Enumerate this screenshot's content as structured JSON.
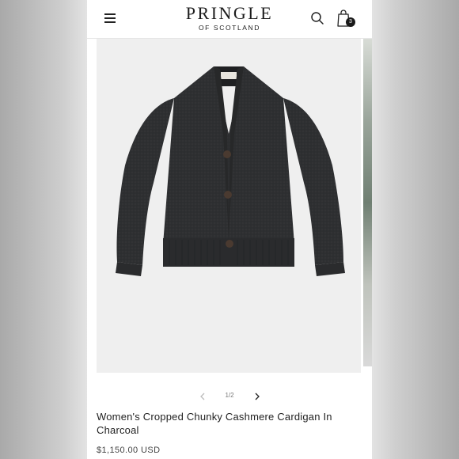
{
  "header": {
    "brand": "PRINGLE",
    "brand_sub": "OF SCOTLAND",
    "cart_count": "3",
    "icons": {
      "menu": "menu-icon",
      "search": "search-icon",
      "cart": "shopping-bag-icon"
    }
  },
  "gallery": {
    "counter": "1/2",
    "icons": {
      "prev": "chevron-left-icon",
      "next": "chevron-right-icon"
    }
  },
  "product": {
    "title": "Women's Cropped Chunky Cashmere Cardigan In Charcoal",
    "price": "$1,150.00 USD"
  },
  "colors": {
    "garment": "#2e2f31",
    "gallery_background": "#efefef",
    "text": "#222222"
  }
}
